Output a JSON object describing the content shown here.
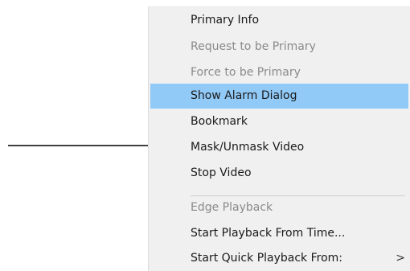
{
  "menu": {
    "items": [
      {
        "label": "Primary Info",
        "state": "enabled"
      },
      {
        "label": "Request to be Primary",
        "state": "disabled"
      },
      {
        "label": "Force to be Primary",
        "state": "disabled"
      },
      {
        "label": "Show Alarm Dialog",
        "state": "highlighted"
      },
      {
        "label": "Bookmark",
        "state": "enabled"
      },
      {
        "label": "Mask/Unmask Video",
        "state": "enabled"
      },
      {
        "label": "Stop Video",
        "state": "enabled"
      },
      {
        "label": "Edge Playback",
        "state": "disabled"
      },
      {
        "label": "Start Playback From Time...",
        "state": "enabled"
      },
      {
        "label": "Start Quick Playback From:",
        "state": "enabled",
        "submenu_glyph": ">"
      }
    ]
  },
  "colors": {
    "menu_background": "#f0f0f0",
    "highlight": "#91c9f7",
    "text": "#1a1a1a",
    "disabled_text": "#8a8a8a",
    "arrow": "#000000"
  },
  "icons": {
    "pointer_arrow": "right-arrow-icon",
    "submenu": "chevron-right-icon"
  }
}
